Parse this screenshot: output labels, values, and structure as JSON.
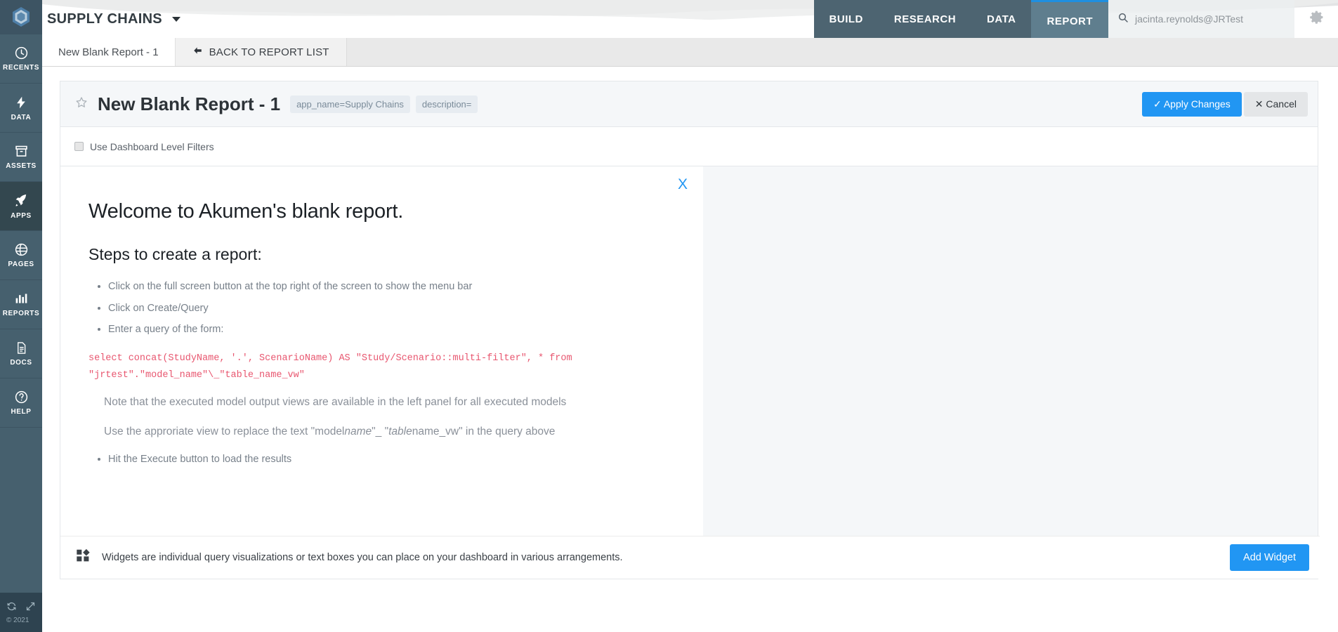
{
  "rail": {
    "logo_icon": "akumen-hexagon-logo",
    "items": [
      {
        "label": "RECENTS",
        "icon": "clock-icon",
        "active": false
      },
      {
        "label": "DATA",
        "icon": "bolt-icon",
        "active": false
      },
      {
        "label": "ASSETS",
        "icon": "archive-icon",
        "active": false
      },
      {
        "label": "APPS",
        "icon": "rocket-icon",
        "active": true
      },
      {
        "label": "PAGES",
        "icon": "globe-icon",
        "active": false
      },
      {
        "label": "REPORTS",
        "icon": "bar-chart-icon",
        "active": false
      },
      {
        "label": "DOCS",
        "icon": "document-icon",
        "active": false
      },
      {
        "label": "HELP",
        "icon": "question-circle-icon",
        "active": false
      }
    ],
    "refresh_icon": "refresh-icon",
    "expand_icon": "expand-icon",
    "copyright": "© 2021"
  },
  "header": {
    "app_name": "SUPPLY CHAINS",
    "nav_tabs": [
      {
        "label": "BUILD",
        "active": false
      },
      {
        "label": "RESEARCH",
        "active": false
      },
      {
        "label": "DATA",
        "active": false
      },
      {
        "label": "REPORT",
        "active": true
      }
    ],
    "search": {
      "icon": "search-icon",
      "value": "jacinta.reynolds@JRTest",
      "placeholder": "Search"
    },
    "gear_icon": "gear-icon"
  },
  "tab_strip": {
    "document_tab": "New Blank Report - 1",
    "back_button": "BACK TO REPORT LIST",
    "back_icon": "arrow-left-icon"
  },
  "report": {
    "star_icon": "star-outline-icon",
    "title": "New Blank Report - 1",
    "badges": [
      "app_name=Supply Chains",
      "description="
    ],
    "apply_label": "Apply Changes",
    "apply_icon": "check-icon",
    "cancel_label": "Cancel",
    "cancel_icon": "times-icon",
    "filters_label": "Use Dashboard Level Filters",
    "filters_checked": false
  },
  "welcome_card": {
    "close_icon": "close-icon",
    "close_label": "X",
    "heading": "Welcome to Akumen's blank report.",
    "subheading": "Steps to create a report:",
    "steps": [
      "Click on the full screen button at the top right of the screen to show the menu bar",
      "Click on Create/Query",
      "Enter a query of the form:"
    ],
    "code_line_1": "select concat(StudyName, '.', ScenarioName) AS \"Study/Scenario::multi-filter\", * from",
    "code_line_2": "\"jrtest\".\"model_name\"\\_\"table_name_vw\"",
    "note_1": "Note that the executed model output views are available in the left panel for all executed models",
    "note_2_prefix": "Use the approriate view to replace the text \"model",
    "note_2_em1": "name",
    "note_2_mid": "\"_ \"",
    "note_2_em2": "table",
    "note_2_suffix": "name_vw\" in the query above",
    "final_steps": [
      "Hit the Execute button to load the results"
    ]
  },
  "widget_bar": {
    "icon": "dashboard-widgets-icon",
    "text": "Widgets are individual query visualizations or text boxes you can place on your dashboard in various arrangements.",
    "add_button": "Add Widget"
  },
  "colors": {
    "rail_bg": "#46606e",
    "rail_active": "#33474f",
    "nav_bg": "#4d6471",
    "nav_active": "#5f7e8e",
    "accent_blue": "#2196f3",
    "active_tab_border": "#1f8fe0",
    "code_red": "#e8566f",
    "canvas_bg": "#f5f7f9"
  }
}
